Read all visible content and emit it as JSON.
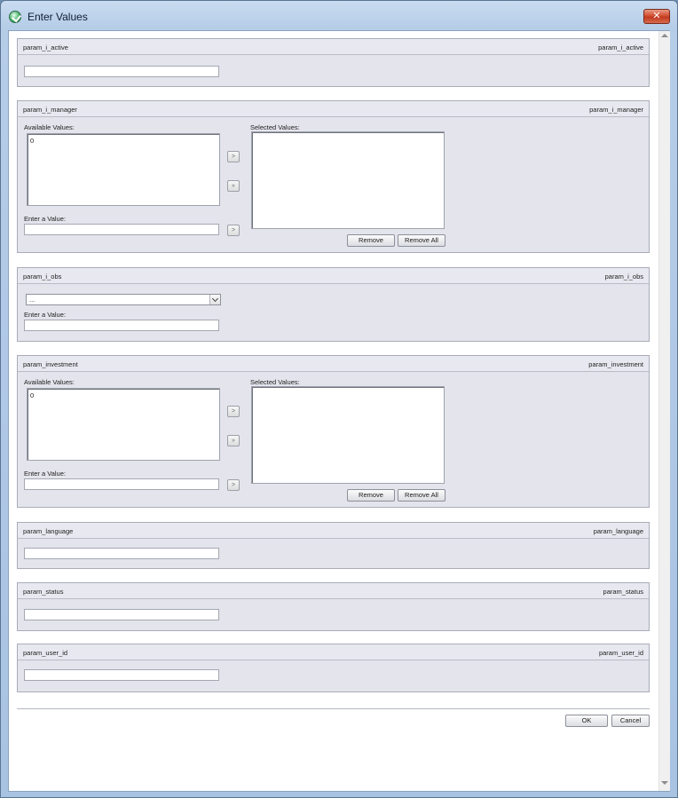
{
  "window": {
    "title": "Enter Values",
    "close_glyph": "✕",
    "icon": "app-icon"
  },
  "panels": {
    "active": {
      "header_left": "param_i_active",
      "header_right": "param_i_active"
    },
    "manager": {
      "header_left": "param_i_manager",
      "header_right": "param_i_manager",
      "available_label": "Available Values:",
      "available_items": [
        "0"
      ],
      "selected_label": "Selected Values:",
      "enter_label": "Enter a Value:",
      "move_glyph": ">",
      "move_all_glyph": "»",
      "remove": "Remove",
      "remove_all": "Remove All"
    },
    "obs": {
      "header_left": "param_i_obs",
      "header_right": "param_i_obs",
      "select_value": "...",
      "enter_label": "Enter a Value:"
    },
    "investment": {
      "header_left": "param_investment",
      "header_right": "param_investment",
      "available_label": "Available Values:",
      "available_items": [
        "0"
      ],
      "selected_label": "Selected Values:",
      "enter_label": "Enter a Value:",
      "move_glyph": ">",
      "move_all_glyph": "»",
      "remove": "Remove",
      "remove_all": "Remove All"
    },
    "language": {
      "header_left": "param_language",
      "header_right": "param_language"
    },
    "status": {
      "header_left": "param_status",
      "header_right": "param_status"
    },
    "user_id": {
      "header_left": "param_user_id",
      "header_right": "param_user_id"
    }
  },
  "footer": {
    "ok": "OK",
    "cancel": "Cancel"
  },
  "colors": {
    "panel_bg": "#e3e4ec",
    "close": "#c13a20"
  }
}
